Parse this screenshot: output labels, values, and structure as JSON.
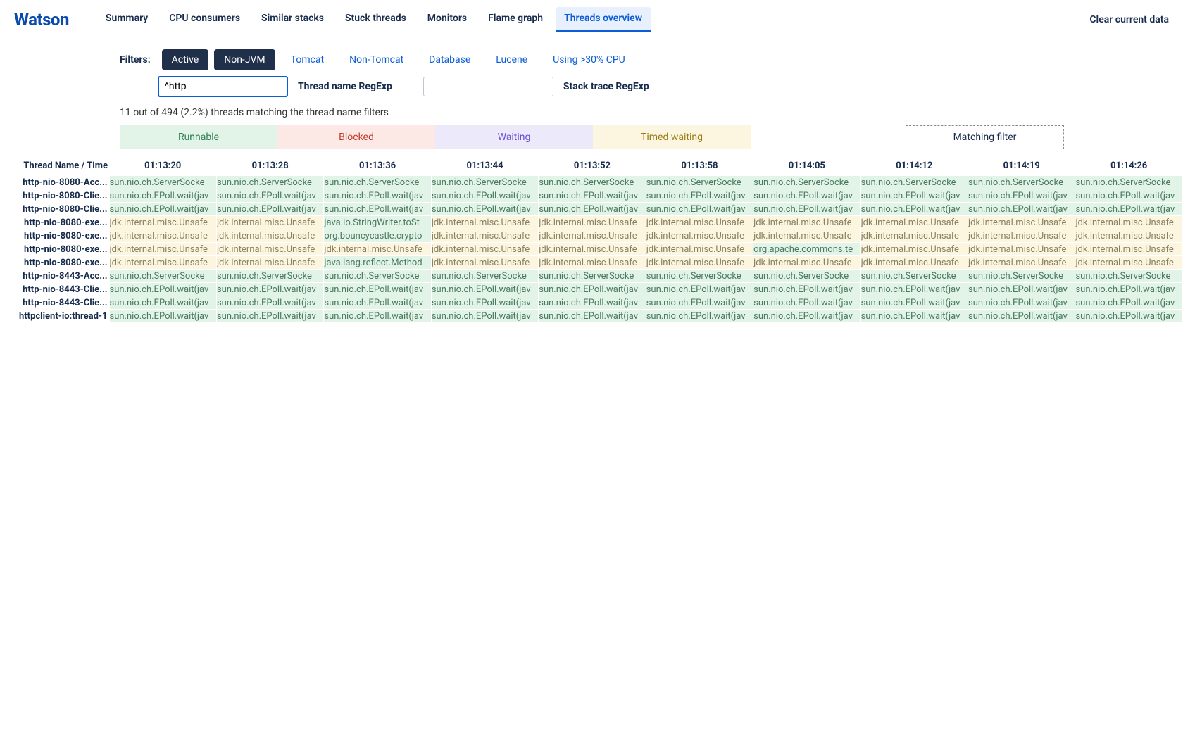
{
  "logo": "Watson",
  "nav": {
    "tabs": [
      "Summary",
      "CPU consumers",
      "Similar stacks",
      "Stuck threads",
      "Monitors",
      "Flame graph",
      "Threads overview"
    ],
    "activeIndex": 6
  },
  "clearData": "Clear current data",
  "filters": {
    "label": "Filters:",
    "chips": [
      {
        "label": "Active",
        "on": true
      },
      {
        "label": "Non-JVM",
        "on": true
      },
      {
        "label": "Tomcat",
        "on": false
      },
      {
        "label": "Non-Tomcat",
        "on": false
      },
      {
        "label": "Database",
        "on": false
      },
      {
        "label": "Lucene",
        "on": false
      },
      {
        "label": "Using >30% CPU",
        "on": false
      }
    ],
    "threadNameRegexp": {
      "value": "^http",
      "label": "Thread name RegExp"
    },
    "stackTraceRegexp": {
      "value": "",
      "label": "Stack trace RegExp"
    }
  },
  "matchingText": "11 out of 494 (2.2%) threads matching the thread name filters",
  "legend": {
    "runnable": "Runnable",
    "blocked": "Blocked",
    "waiting": "Waiting",
    "timed": "Timed waiting",
    "matching": "Matching filter"
  },
  "table": {
    "nameHeader": "Thread Name / Time",
    "times": [
      "01:13:20",
      "01:13:28",
      "01:13:36",
      "01:13:44",
      "01:13:52",
      "01:13:58",
      "01:14:05",
      "01:14:12",
      "01:14:19",
      "01:14:26"
    ],
    "rows": [
      {
        "name": "http-nio-8080-Acc...",
        "cells": [
          {
            "t": "sun.nio.ch.ServerSocke",
            "s": "run"
          },
          {
            "t": "sun.nio.ch.ServerSocke",
            "s": "run"
          },
          {
            "t": "sun.nio.ch.ServerSocke",
            "s": "run"
          },
          {
            "t": "sun.nio.ch.ServerSocke",
            "s": "run"
          },
          {
            "t": "sun.nio.ch.ServerSocke",
            "s": "run"
          },
          {
            "t": "sun.nio.ch.ServerSocke",
            "s": "run"
          },
          {
            "t": "sun.nio.ch.ServerSocke",
            "s": "run"
          },
          {
            "t": "sun.nio.ch.ServerSocke",
            "s": "run"
          },
          {
            "t": "sun.nio.ch.ServerSocke",
            "s": "run"
          },
          {
            "t": "sun.nio.ch.ServerSocke",
            "s": "run"
          }
        ]
      },
      {
        "name": "http-nio-8080-Clie...",
        "cells": [
          {
            "t": "sun.nio.ch.EPoll.wait(jav",
            "s": "run"
          },
          {
            "t": "sun.nio.ch.EPoll.wait(jav",
            "s": "run"
          },
          {
            "t": "sun.nio.ch.EPoll.wait(jav",
            "s": "run"
          },
          {
            "t": "sun.nio.ch.EPoll.wait(jav",
            "s": "run"
          },
          {
            "t": "sun.nio.ch.EPoll.wait(jav",
            "s": "run"
          },
          {
            "t": "sun.nio.ch.EPoll.wait(jav",
            "s": "run"
          },
          {
            "t": "sun.nio.ch.EPoll.wait(jav",
            "s": "run"
          },
          {
            "t": "sun.nio.ch.EPoll.wait(jav",
            "s": "run"
          },
          {
            "t": "sun.nio.ch.EPoll.wait(jav",
            "s": "run"
          },
          {
            "t": "sun.nio.ch.EPoll.wait(jav",
            "s": "run"
          }
        ]
      },
      {
        "name": "http-nio-8080-Clie...",
        "cells": [
          {
            "t": "sun.nio.ch.EPoll.wait(jav",
            "s": "run"
          },
          {
            "t": "sun.nio.ch.EPoll.wait(jav",
            "s": "run"
          },
          {
            "t": "sun.nio.ch.EPoll.wait(jav",
            "s": "run"
          },
          {
            "t": "sun.nio.ch.EPoll.wait(jav",
            "s": "run"
          },
          {
            "t": "sun.nio.ch.EPoll.wait(jav",
            "s": "run"
          },
          {
            "t": "sun.nio.ch.EPoll.wait(jav",
            "s": "run"
          },
          {
            "t": "sun.nio.ch.EPoll.wait(jav",
            "s": "run"
          },
          {
            "t": "sun.nio.ch.EPoll.wait(jav",
            "s": "run"
          },
          {
            "t": "sun.nio.ch.EPoll.wait(jav",
            "s": "run"
          },
          {
            "t": "sun.nio.ch.EPoll.wait(jav",
            "s": "run"
          }
        ]
      },
      {
        "name": "http-nio-8080-exe...",
        "cells": [
          {
            "t": "jdk.internal.misc.Unsafe",
            "s": "timed"
          },
          {
            "t": "jdk.internal.misc.Unsafe",
            "s": "timed"
          },
          {
            "t": "java.io.StringWriter.toSt",
            "s": "run"
          },
          {
            "t": "jdk.internal.misc.Unsafe",
            "s": "timed"
          },
          {
            "t": "jdk.internal.misc.Unsafe",
            "s": "timed"
          },
          {
            "t": "jdk.internal.misc.Unsafe",
            "s": "timed"
          },
          {
            "t": "jdk.internal.misc.Unsafe",
            "s": "timed"
          },
          {
            "t": "jdk.internal.misc.Unsafe",
            "s": "timed"
          },
          {
            "t": "jdk.internal.misc.Unsafe",
            "s": "timed"
          },
          {
            "t": "jdk.internal.misc.Unsafe",
            "s": "timed"
          }
        ]
      },
      {
        "name": "http-nio-8080-exe...",
        "cells": [
          {
            "t": "jdk.internal.misc.Unsafe",
            "s": "timed"
          },
          {
            "t": "jdk.internal.misc.Unsafe",
            "s": "timed"
          },
          {
            "t": "org.bouncycastle.crypto",
            "s": "run"
          },
          {
            "t": "jdk.internal.misc.Unsafe",
            "s": "timed"
          },
          {
            "t": "jdk.internal.misc.Unsafe",
            "s": "timed"
          },
          {
            "t": "jdk.internal.misc.Unsafe",
            "s": "timed"
          },
          {
            "t": "jdk.internal.misc.Unsafe",
            "s": "timed"
          },
          {
            "t": "jdk.internal.misc.Unsafe",
            "s": "timed"
          },
          {
            "t": "jdk.internal.misc.Unsafe",
            "s": "timed"
          },
          {
            "t": "jdk.internal.misc.Unsafe",
            "s": "timed"
          }
        ]
      },
      {
        "name": "http-nio-8080-exe...",
        "cells": [
          {
            "t": "jdk.internal.misc.Unsafe",
            "s": "timed"
          },
          {
            "t": "jdk.internal.misc.Unsafe",
            "s": "timed"
          },
          {
            "t": "jdk.internal.misc.Unsafe",
            "s": "timed"
          },
          {
            "t": "jdk.internal.misc.Unsafe",
            "s": "timed"
          },
          {
            "t": "jdk.internal.misc.Unsafe",
            "s": "timed"
          },
          {
            "t": "jdk.internal.misc.Unsafe",
            "s": "timed"
          },
          {
            "t": "org.apache.commons.te",
            "s": "run"
          },
          {
            "t": "jdk.internal.misc.Unsafe",
            "s": "timed"
          },
          {
            "t": "jdk.internal.misc.Unsafe",
            "s": "timed"
          },
          {
            "t": "jdk.internal.misc.Unsafe",
            "s": "timed"
          }
        ]
      },
      {
        "name": "http-nio-8080-exe...",
        "cells": [
          {
            "t": "jdk.internal.misc.Unsafe",
            "s": "timed"
          },
          {
            "t": "jdk.internal.misc.Unsafe",
            "s": "timed"
          },
          {
            "t": "java.lang.reflect.Method",
            "s": "run"
          },
          {
            "t": "jdk.internal.misc.Unsafe",
            "s": "timed"
          },
          {
            "t": "jdk.internal.misc.Unsafe",
            "s": "timed"
          },
          {
            "t": "jdk.internal.misc.Unsafe",
            "s": "timed"
          },
          {
            "t": "jdk.internal.misc.Unsafe",
            "s": "timed"
          },
          {
            "t": "jdk.internal.misc.Unsafe",
            "s": "timed"
          },
          {
            "t": "jdk.internal.misc.Unsafe",
            "s": "timed"
          },
          {
            "t": "jdk.internal.misc.Unsafe",
            "s": "timed"
          }
        ]
      },
      {
        "name": "http-nio-8443-Acc...",
        "cells": [
          {
            "t": "sun.nio.ch.ServerSocke",
            "s": "run"
          },
          {
            "t": "sun.nio.ch.ServerSocke",
            "s": "run"
          },
          {
            "t": "sun.nio.ch.ServerSocke",
            "s": "run"
          },
          {
            "t": "sun.nio.ch.ServerSocke",
            "s": "run"
          },
          {
            "t": "sun.nio.ch.ServerSocke",
            "s": "run"
          },
          {
            "t": "sun.nio.ch.ServerSocke",
            "s": "run"
          },
          {
            "t": "sun.nio.ch.ServerSocke",
            "s": "run"
          },
          {
            "t": "sun.nio.ch.ServerSocke",
            "s": "run"
          },
          {
            "t": "sun.nio.ch.ServerSocke",
            "s": "run"
          },
          {
            "t": "sun.nio.ch.ServerSocke",
            "s": "run"
          }
        ]
      },
      {
        "name": "http-nio-8443-Clie...",
        "cells": [
          {
            "t": "sun.nio.ch.EPoll.wait(jav",
            "s": "run"
          },
          {
            "t": "sun.nio.ch.EPoll.wait(jav",
            "s": "run"
          },
          {
            "t": "sun.nio.ch.EPoll.wait(jav",
            "s": "run"
          },
          {
            "t": "sun.nio.ch.EPoll.wait(jav",
            "s": "run"
          },
          {
            "t": "sun.nio.ch.EPoll.wait(jav",
            "s": "run"
          },
          {
            "t": "sun.nio.ch.EPoll.wait(jav",
            "s": "run"
          },
          {
            "t": "sun.nio.ch.EPoll.wait(jav",
            "s": "run"
          },
          {
            "t": "sun.nio.ch.EPoll.wait(jav",
            "s": "run"
          },
          {
            "t": "sun.nio.ch.EPoll.wait(jav",
            "s": "run"
          },
          {
            "t": "sun.nio.ch.EPoll.wait(jav",
            "s": "run"
          }
        ]
      },
      {
        "name": "http-nio-8443-Clie...",
        "cells": [
          {
            "t": "sun.nio.ch.EPoll.wait(jav",
            "s": "run"
          },
          {
            "t": "sun.nio.ch.EPoll.wait(jav",
            "s": "run"
          },
          {
            "t": "sun.nio.ch.EPoll.wait(jav",
            "s": "run"
          },
          {
            "t": "sun.nio.ch.EPoll.wait(jav",
            "s": "run"
          },
          {
            "t": "sun.nio.ch.EPoll.wait(jav",
            "s": "run"
          },
          {
            "t": "sun.nio.ch.EPoll.wait(jav",
            "s": "run"
          },
          {
            "t": "sun.nio.ch.EPoll.wait(jav",
            "s": "run"
          },
          {
            "t": "sun.nio.ch.EPoll.wait(jav",
            "s": "run"
          },
          {
            "t": "sun.nio.ch.EPoll.wait(jav",
            "s": "run"
          },
          {
            "t": "sun.nio.ch.EPoll.wait(jav",
            "s": "run"
          }
        ]
      },
      {
        "name": "httpclient-io:thread-1",
        "cells": [
          {
            "t": "sun.nio.ch.EPoll.wait(jav",
            "s": "run"
          },
          {
            "t": "sun.nio.ch.EPoll.wait(jav",
            "s": "run"
          },
          {
            "t": "sun.nio.ch.EPoll.wait(jav",
            "s": "run"
          },
          {
            "t": "sun.nio.ch.EPoll.wait(jav",
            "s": "run"
          },
          {
            "t": "sun.nio.ch.EPoll.wait(jav",
            "s": "run"
          },
          {
            "t": "sun.nio.ch.EPoll.wait(jav",
            "s": "run"
          },
          {
            "t": "sun.nio.ch.EPoll.wait(jav",
            "s": "run"
          },
          {
            "t": "sun.nio.ch.EPoll.wait(jav",
            "s": "run"
          },
          {
            "t": "sun.nio.ch.EPoll.wait(jav",
            "s": "run"
          },
          {
            "t": "sun.nio.ch.EPoll.wait(jav",
            "s": "run"
          }
        ]
      }
    ]
  }
}
